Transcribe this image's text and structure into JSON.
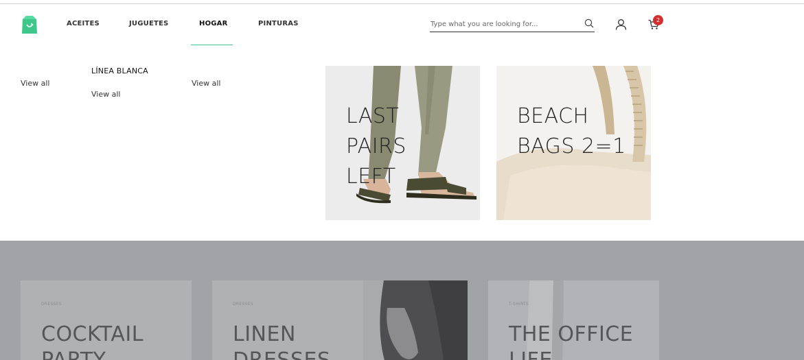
{
  "brand": {
    "logo_icon": "shopping-bag-icon",
    "accent": "#3ec78a"
  },
  "nav": {
    "items": [
      {
        "label": "ACEITES"
      },
      {
        "label": "JUGUETES"
      },
      {
        "label": "HOGAR",
        "active": true
      },
      {
        "label": "PINTURAS"
      }
    ]
  },
  "search": {
    "placeholder": "Type what you are looking for...",
    "value": ""
  },
  "cart": {
    "count": "2",
    "badge_color": "#d32f2f"
  },
  "mega_menu": {
    "col1": {
      "link": "View all"
    },
    "col2": {
      "heading": "LÍNEA BLANCA",
      "link": "View all"
    },
    "col3": {
      "link": "View all"
    },
    "promos": [
      {
        "title": "LAST\nPAIRS\nLEFT",
        "image": "sandals-photo"
      },
      {
        "title": "BEACH\nBAGS 2=1",
        "image": "tote-bag-photo"
      }
    ]
  },
  "cards": [
    {
      "category": "DRESSES",
      "title": "COCKTAIL\nPARTY"
    },
    {
      "category": "DRESSES",
      "title": "LINEN\nDRESSES"
    },
    {
      "category": "T-SHIRTS",
      "title": "THE OFFICE\nLIFE"
    }
  ],
  "overlay_color": "#a2a3a8"
}
